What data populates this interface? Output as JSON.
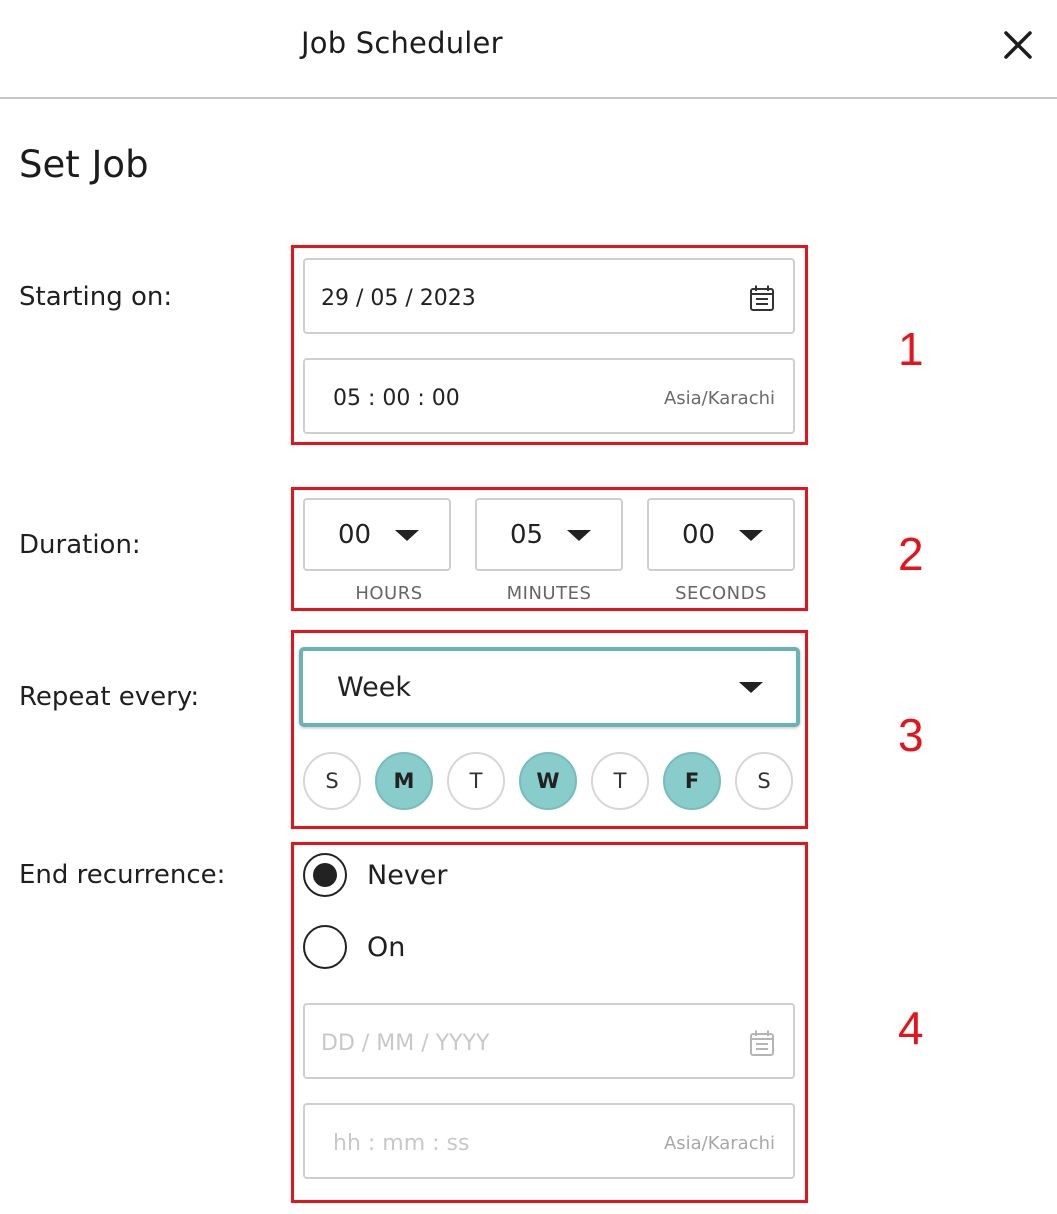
{
  "header": {
    "title": "Job Scheduler",
    "close_icon": "close-icon"
  },
  "section": {
    "title": "Set Job"
  },
  "labels": {
    "starting_on": "Starting on:",
    "duration": "Duration:",
    "repeat_every": "Repeat every:",
    "end_recurrence": "End recurrence:"
  },
  "start": {
    "date": "29 / 05 / 2023",
    "time": "05 : 00 : 00",
    "timezone": "Asia/Karachi",
    "calendar_icon": "calendar-icon"
  },
  "duration": {
    "hours": {
      "value": "00",
      "caption": "HOURS"
    },
    "minutes": {
      "value": "05",
      "caption": "MINUTES"
    },
    "seconds": {
      "value": "00",
      "caption": "SECONDS"
    }
  },
  "repeat": {
    "value": "Week",
    "days": [
      {
        "label": "S",
        "selected": false
      },
      {
        "label": "M",
        "selected": true
      },
      {
        "label": "T",
        "selected": false
      },
      {
        "label": "W",
        "selected": true
      },
      {
        "label": "T",
        "selected": false
      },
      {
        "label": "F",
        "selected": true
      },
      {
        "label": "S",
        "selected": false
      }
    ]
  },
  "end": {
    "options": [
      {
        "label": "Never",
        "checked": true
      },
      {
        "label": "On",
        "checked": false
      }
    ],
    "date_placeholder": "DD / MM / YYYY",
    "time_placeholder": "hh : mm : ss",
    "timezone": "Asia/Karachi"
  },
  "annotations": [
    "1",
    "2",
    "3",
    "4"
  ],
  "colors": {
    "accent": "#88cccc",
    "accent_border": "#6ab3b4",
    "annotation": "#e3141b"
  }
}
